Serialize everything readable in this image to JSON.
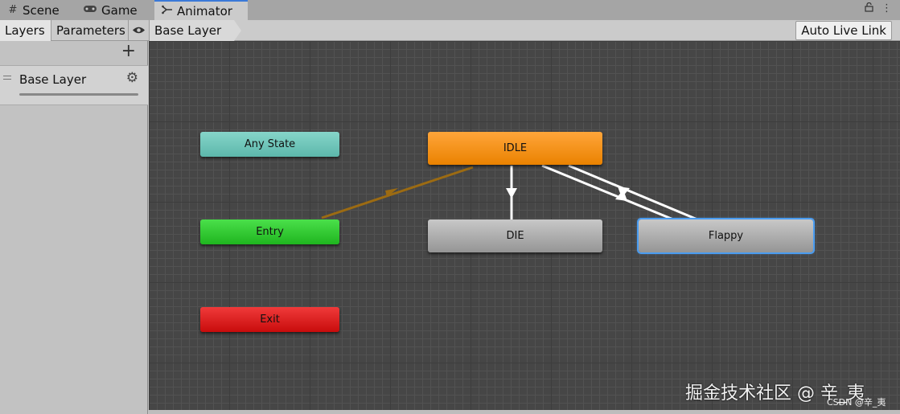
{
  "tabs": [
    {
      "label": "Scene",
      "icon": "grid-icon"
    },
    {
      "label": "Game",
      "icon": "gamepad-icon"
    },
    {
      "label": "Animator",
      "icon": "animator-icon"
    }
  ],
  "toolbar": {
    "layers_label": "Layers",
    "parameters_label": "Parameters",
    "breadcrumb": "Base Layer",
    "auto_live_link_label": "Auto Live Link"
  },
  "layers_panel": {
    "add_label": "+",
    "layers": [
      {
        "name": "Base Layer"
      }
    ]
  },
  "graph": {
    "states": {
      "any_state": "Any State",
      "entry": "Entry",
      "exit": "Exit",
      "idle": "IDLE",
      "die": "DIE",
      "flappy": "Flappy"
    },
    "colors": {
      "any_state": "#6fc6bb",
      "entry": "#2ac92a",
      "exit": "#dc1f1f",
      "default_state": "#f29016",
      "state": "#b0b0b0",
      "selected_outline": "#4a9cf0",
      "default_transition": "#9c6b12",
      "transition": "#ffffff"
    }
  },
  "watermark": {
    "main": "掘金技术社区 @ 辛_夷",
    "sub": "CSDN @辛_夷"
  }
}
